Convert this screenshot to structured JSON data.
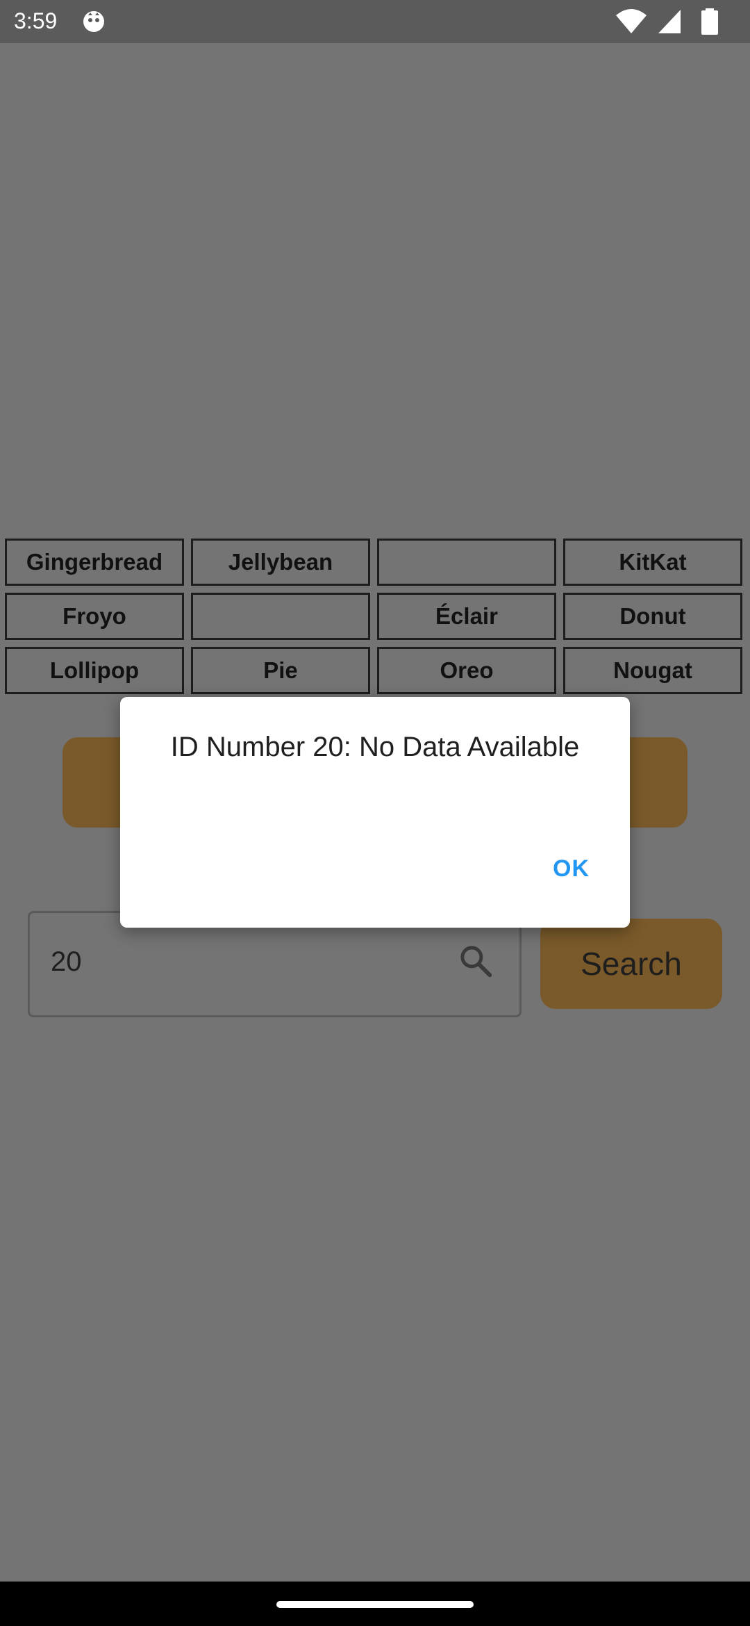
{
  "status_bar": {
    "time": "3:59",
    "icons": [
      "app-notification-icon",
      "wifi-icon",
      "cell-signal-icon",
      "battery-icon"
    ]
  },
  "grid": {
    "cells": [
      "Gingerbread",
      "Jellybean",
      "",
      "KitKat",
      "Froyo",
      "",
      "Éclair",
      "Donut",
      "Lollipop",
      "Pie",
      "Oreo",
      "Nougat"
    ]
  },
  "search": {
    "value": "20",
    "button_label": "Search"
  },
  "dialog": {
    "message": "ID Number 20: No Data Available",
    "ok_label": "OK"
  },
  "colors": {
    "accent": "#2196f3",
    "button_orange": "#e8a030",
    "scrim": "#747474"
  }
}
